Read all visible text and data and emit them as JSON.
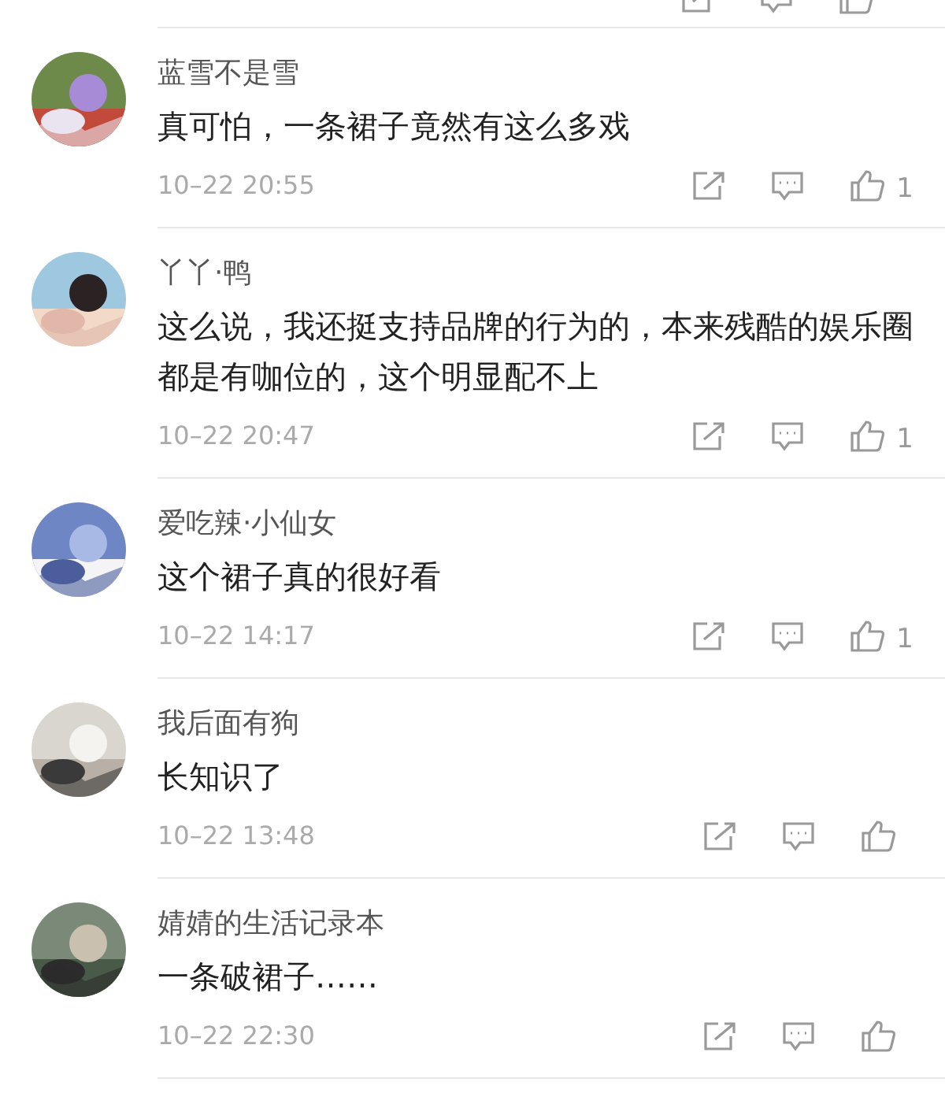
{
  "comments": [
    {
      "name": "蓝雪不是雪",
      "text": "真可怕，一条裙子竟然有这么多戏",
      "time": "10–22 20:55",
      "likes": "1"
    },
    {
      "name": "丫丫·鸭",
      "text": "这么说，我还挺支持品牌的行为的，本来残酷的娱乐圈都是有咖位的，这个明显配不上",
      "time": "10–22 20:47",
      "likes": "1"
    },
    {
      "name": "爱吃辣·小仙女",
      "text": "这个裙子真的很好看",
      "time": "10–22 14:17",
      "likes": "1"
    },
    {
      "name": "我后面有狗",
      "text": "长知识了",
      "time": "10–22 13:48"
    },
    {
      "name": "婧婧的生活记录本",
      "text": "一条破裙子……",
      "time": "10–22 22:30"
    }
  ]
}
